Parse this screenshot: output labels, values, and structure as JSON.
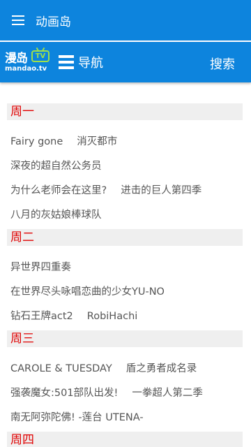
{
  "appbar": {
    "menu_icon": "hamburger-menu-icon",
    "title": "动画岛"
  },
  "site": {
    "logo_text": "漫岛",
    "logo_badge": "TV",
    "logo_url": "mandao.tv",
    "nav_icon": "list-icon",
    "nav_label": "导航",
    "search_label": "搜索"
  },
  "colors": {
    "header": "#0d84dd",
    "day_heading": "#e00000",
    "day_bg": "#efefef",
    "text": "#555555"
  },
  "schedule": [
    {
      "day": "周一",
      "rows": [
        [
          "Fairy gone",
          "消灭都市"
        ],
        [
          "深夜的超自然公务员"
        ],
        [
          "为什么老师会在这里?",
          "进击的巨人第四季"
        ],
        [
          "八月的灰姑娘棒球队"
        ]
      ]
    },
    {
      "day": "周二",
      "rows": [
        [
          "异世界四重奏"
        ],
        [
          "在世界尽头咏唱恋曲的少女YU-NO"
        ],
        [
          "钻石王牌act2",
          "RobiHachi"
        ]
      ]
    },
    {
      "day": "周三",
      "rows": [
        [
          "CAROLE & TUESDAY",
          "盾之勇者成名录"
        ],
        [
          "强袭魔女:501部队出发!",
          "一拳超人第二季"
        ],
        [
          "南无阿弥陀佛! -莲台 UTENA-"
        ]
      ]
    },
    {
      "day": "周四",
      "rows": []
    }
  ]
}
